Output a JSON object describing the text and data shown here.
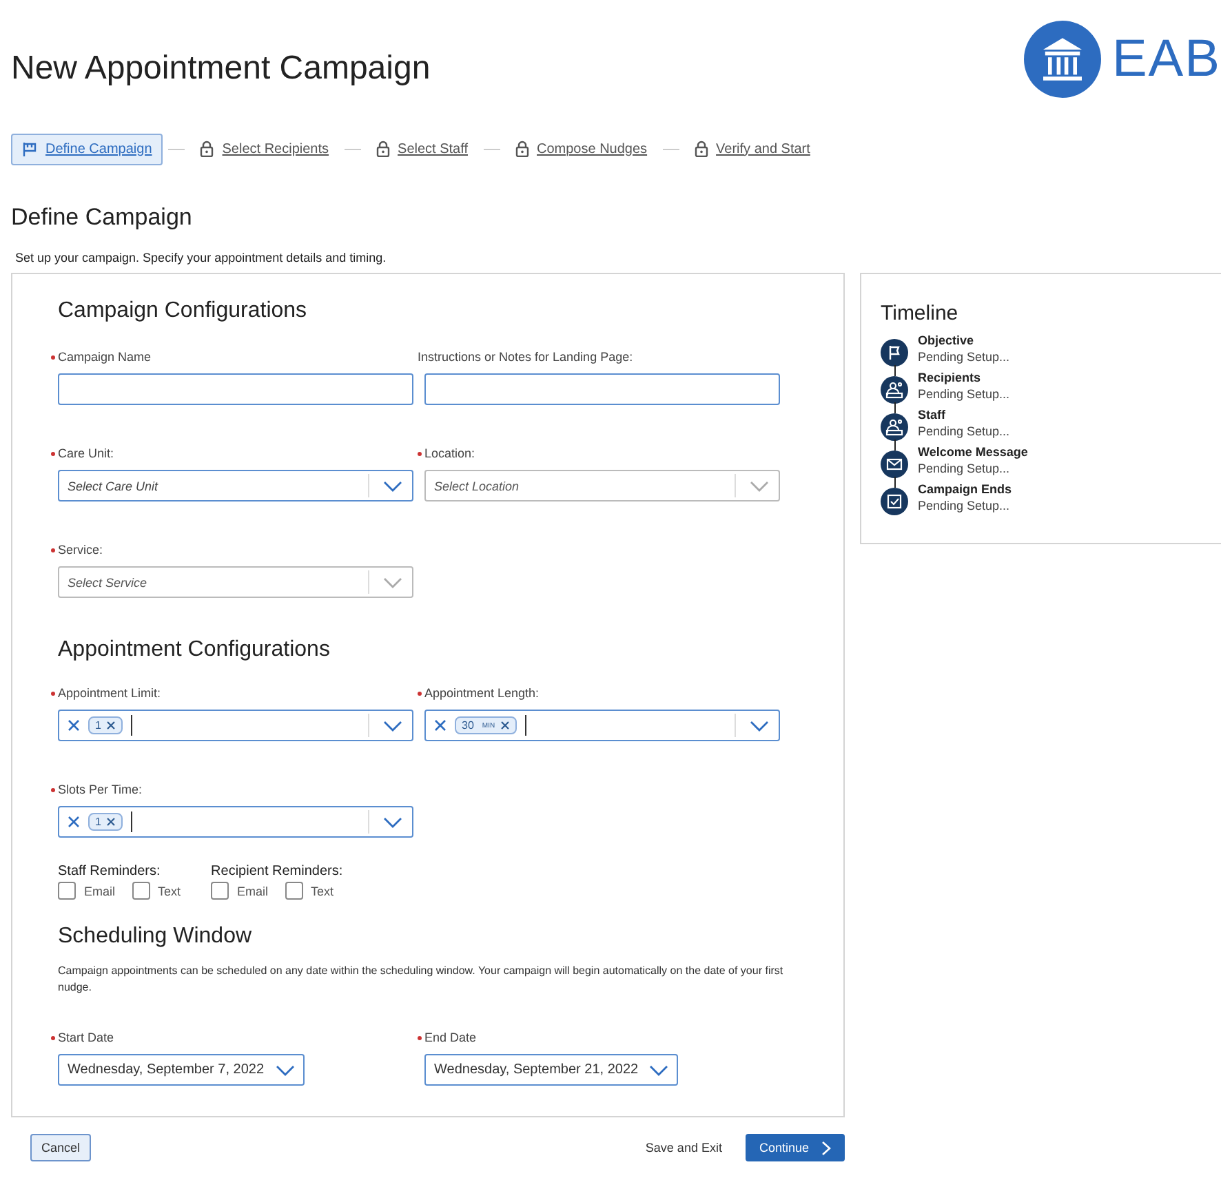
{
  "page": {
    "title": "New Appointment Campaign",
    "logo": "EAB"
  },
  "steps": [
    {
      "label": "Define Campaign",
      "selected": true,
      "locked": false
    },
    {
      "label": "Select Recipients",
      "selected": false,
      "locked": true
    },
    {
      "label": "Select Staff",
      "selected": false,
      "locked": true
    },
    {
      "label": "Compose Nudges",
      "selected": false,
      "locked": true
    },
    {
      "label": "Verify and Start",
      "selected": false,
      "locked": true
    }
  ],
  "heading": "Define Campaign",
  "description": "Set up your campaign. Specify your appointment details and timing.",
  "sections": [
    {
      "title": "Campaign Configurations",
      "rows": [
        [
          {
            "kind": "text",
            "label": "Campaign Name",
            "required": true
          },
          {
            "kind": "text",
            "label": "Instructions or Notes for Landing Page:",
            "required": false
          }
        ],
        [
          {
            "kind": "select",
            "label": "Care Unit:",
            "required": true,
            "placeholder": "Select Care Unit",
            "disabled": false
          },
          {
            "kind": "select",
            "label": "Location:",
            "required": true,
            "placeholder": "Select Location",
            "disabled": true
          }
        ],
        [
          {
            "kind": "select",
            "label": "Service:",
            "required": true,
            "placeholder": "Select Service",
            "disabled": true
          }
        ]
      ]
    },
    {
      "title": "Appointment Configurations",
      "rows": [
        [
          {
            "kind": "multi",
            "label": "Appointment Limit:",
            "required": true,
            "tags": [
              {
                "value": "1"
              }
            ]
          },
          {
            "kind": "multi",
            "label": "Appointment Length:",
            "required": true,
            "tags": [
              {
                "value": "30",
                "unit": "MIN"
              }
            ]
          }
        ],
        [
          {
            "kind": "multi",
            "label": "Slots Per Time:",
            "required": true,
            "tags": [
              {
                "value": "1"
              }
            ]
          }
        ]
      ],
      "reminders": [
        {
          "label": "Staff Reminders:",
          "options": [
            {
              "label": "Email",
              "checked": false
            },
            {
              "label": "Text",
              "checked": false
            }
          ]
        },
        {
          "label": "Recipient Reminders:",
          "options": [
            {
              "label": "Email",
              "checked": false
            },
            {
              "label": "Text",
              "checked": false
            }
          ]
        }
      ]
    },
    {
      "title": "Scheduling Window",
      "note": "Campaign appointments can be scheduled on any date within the scheduling window. Your campaign will begin automatically on the date of your first nudge.",
      "rows": [
        [
          {
            "kind": "date",
            "label": "Start Date",
            "required": true,
            "value": "Wednesday, September 7, 2022"
          },
          {
            "kind": "date",
            "label": "End Date",
            "required": true,
            "value": "Wednesday, September 21, 2022"
          }
        ]
      ]
    }
  ],
  "timeline": {
    "title": "Timeline",
    "items": [
      {
        "kind": "flag",
        "title": "Objective",
        "status": "Pending Setup..."
      },
      {
        "kind": "person",
        "title": "Recipients",
        "status": "Pending Setup..."
      },
      {
        "kind": "person",
        "title": "Staff",
        "status": "Pending Setup..."
      },
      {
        "kind": "mail",
        "title": "Welcome Message",
        "status": "Pending Setup..."
      },
      {
        "kind": "check",
        "title": "Campaign Ends",
        "status": "Pending Setup..."
      }
    ]
  },
  "footer": {
    "cancel": "Cancel",
    "save": "Save and Exit",
    "continue": "Continue"
  }
}
